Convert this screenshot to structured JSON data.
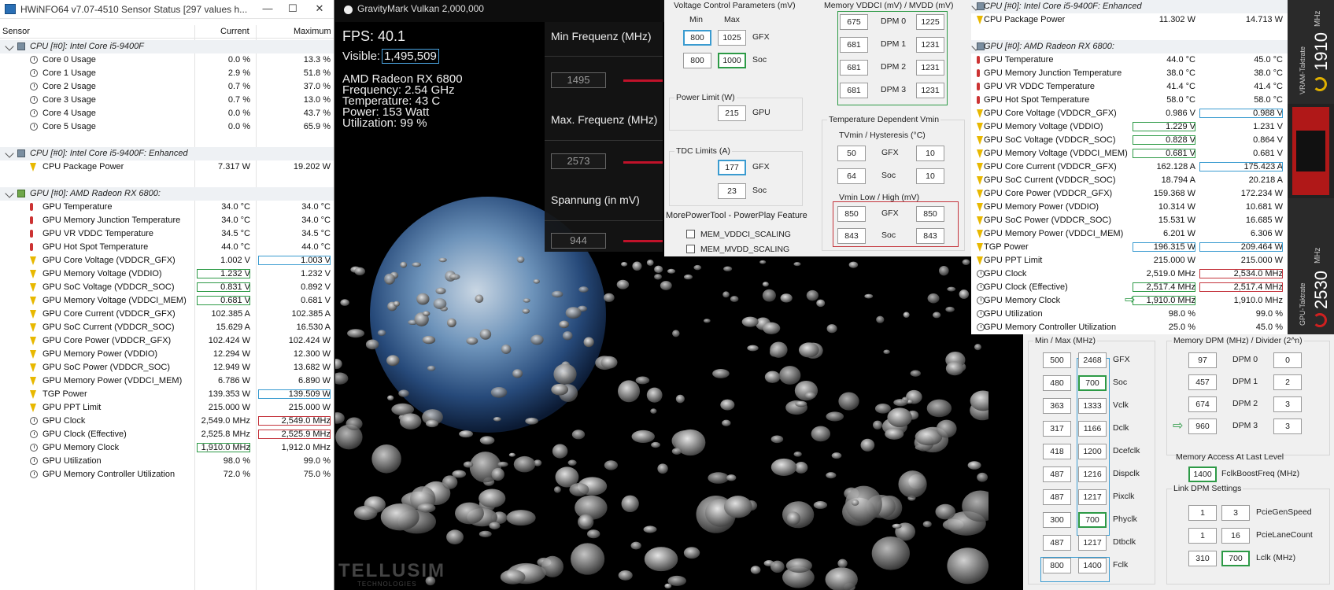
{
  "hwinfo": {
    "title": "HWiNFO64 v7.07-4510 Sensor Status [297 values h...",
    "col_sensor": "Sensor",
    "col_current": "Current",
    "col_max": "Maximum",
    "rows": [
      {
        "t": "g",
        "l": "CPU [#0]: Intel Core i5-9400F",
        "i": "cpu"
      },
      {
        "l": "Core 0 Usage",
        "c": "0.0 %",
        "m": "13.3 %",
        "i": "clock"
      },
      {
        "l": "Core 1 Usage",
        "c": "2.9 %",
        "m": "51.8 %",
        "i": "clock"
      },
      {
        "l": "Core 2 Usage",
        "c": "0.7 %",
        "m": "37.0 %",
        "i": "clock"
      },
      {
        "l": "Core 3 Usage",
        "c": "0.7 %",
        "m": "13.0 %",
        "i": "clock"
      },
      {
        "l": "Core 4 Usage",
        "c": "0.0 %",
        "m": "43.7 %",
        "i": "clock"
      },
      {
        "l": "Core 5 Usage",
        "c": "0.0 %",
        "m": "65.9 %",
        "i": "clock"
      },
      {
        "t": "s"
      },
      {
        "t": "g",
        "l": "CPU [#0]: Intel Core i5-9400F: Enhanced",
        "i": "cpu"
      },
      {
        "l": "CPU Package Power",
        "c": "7.317 W",
        "m": "19.202 W",
        "i": "bolt"
      },
      {
        "t": "s"
      },
      {
        "t": "g",
        "l": "GPU [#0]: AMD Radeon RX 6800:",
        "i": "gpu"
      },
      {
        "l": "GPU Temperature",
        "c": "34.0 °C",
        "m": "34.0 °C",
        "i": "therm"
      },
      {
        "l": "GPU Memory Junction Temperature",
        "c": "34.0 °C",
        "m": "34.0 °C",
        "i": "therm"
      },
      {
        "l": "GPU VR VDDC Temperature",
        "c": "34.5 °C",
        "m": "34.5 °C",
        "i": "therm"
      },
      {
        "l": "GPU Hot Spot Temperature",
        "c": "44.0 °C",
        "m": "44.0 °C",
        "i": "therm"
      },
      {
        "l": "GPU Core Voltage (VDDCR_GFX)",
        "c": "1.002 V",
        "m": "1.003 V",
        "i": "bolt",
        "mb": "b"
      },
      {
        "l": "GPU Memory Voltage (VDDIO)",
        "c": "1.232 V",
        "m": "1.232 V",
        "i": "bolt",
        "cb": "g"
      },
      {
        "l": "GPU SoC Voltage (VDDCR_SOC)",
        "c": "0.831 V",
        "m": "0.892 V",
        "i": "bolt",
        "cb": "g"
      },
      {
        "l": "GPU Memory Voltage (VDDCI_MEM)",
        "c": "0.681 V",
        "m": "0.681 V",
        "i": "bolt",
        "cb": "g"
      },
      {
        "l": "GPU Core Current (VDDCR_GFX)",
        "c": "102.385 A",
        "m": "102.385 A",
        "i": "bolt"
      },
      {
        "l": "GPU SoC Current (VDDCR_SOC)",
        "c": "15.629 A",
        "m": "16.530 A",
        "i": "bolt"
      },
      {
        "l": "GPU Core Power (VDDCR_GFX)",
        "c": "102.424 W",
        "m": "102.424 W",
        "i": "bolt"
      },
      {
        "l": "GPU Memory Power (VDDIO)",
        "c": "12.294 W",
        "m": "12.300 W",
        "i": "bolt"
      },
      {
        "l": "GPU SoC Power (VDDCR_SOC)",
        "c": "12.949 W",
        "m": "13.682 W",
        "i": "bolt"
      },
      {
        "l": "GPU Memory Power (VDDCI_MEM)",
        "c": "6.786 W",
        "m": "6.890 W",
        "i": "bolt"
      },
      {
        "l": "TGP Power",
        "c": "139.353 W",
        "m": "139.509 W",
        "i": "bolt",
        "mb": "b"
      },
      {
        "l": "GPU PPT Limit",
        "c": "215.000 W",
        "m": "215.000 W",
        "i": "bolt"
      },
      {
        "l": "GPU Clock",
        "c": "2,549.0 MHz",
        "m": "2,549.0 MHz",
        "i": "clock",
        "mb": "r"
      },
      {
        "l": "GPU Clock (Effective)",
        "c": "2,525.8 MHz",
        "m": "2,525.9 MHz",
        "i": "clock",
        "mb": "r"
      },
      {
        "l": "GPU Memory Clock",
        "c": "1,910.0 MHz",
        "m": "1,912.0 MHz",
        "i": "clock",
        "cb": "g"
      },
      {
        "l": "GPU Utilization",
        "c": "98.0 %",
        "m": "99.0 %",
        "i": "clock"
      },
      {
        "l": "GPU Memory Controller Utilization",
        "c": "72.0 %",
        "m": "75.0 %",
        "i": "clock"
      }
    ]
  },
  "gravitymark": {
    "title": "GravityMark Vulkan 2,000,000",
    "fps": "FPS: 40.1",
    "visible_label": "Visible:",
    "visible_value": "1,495,509",
    "gpu": "AMD Radeon RX 6800",
    "frequency": "Frequency: 2.54 GHz",
    "temperature": "Temperature: 43 C",
    "power": "Power: 153 Watt",
    "utilization": "Utilization: 99 %",
    "controls": [
      {
        "label": "Min Frequenz (MHz)",
        "value": "1495"
      },
      {
        "label": "Max. Frequenz (MHz)",
        "value": "2573"
      },
      {
        "label": "Spannung (in mV)",
        "value": "944"
      }
    ],
    "watermark": "TELLUSIM",
    "watermark_sub": "TECHNOLOGIES"
  },
  "mpt1": {
    "vcp_title": "Voltage Control Parameters (mV)",
    "min": "Min",
    "max": "Max",
    "gfx_min": "800",
    "gfx_max": "1025",
    "soc_min": "800",
    "soc_max": "1000",
    "gfx": "GFX",
    "soc": "Soc",
    "pl_title": "Power Limit (W)",
    "pl": "215",
    "gpu": "GPU",
    "tdc_title": "TDC Limits (A)",
    "tdc_gfx": "177",
    "tdc_soc": "23",
    "feature_title": "MorePowerTool - PowerPlay Feature",
    "feat1": "MEM_VDDCI_SCALING",
    "feat2": "MEM_MVDD_SCALING",
    "mem_title": "Memory VDDCI (mV) / MVDD (mV)",
    "dpm": [
      {
        "a": "675",
        "l": "DPM 0",
        "b": "1225"
      },
      {
        "a": "681",
        "l": "DPM 1",
        "b": "1231"
      },
      {
        "a": "681",
        "l": "DPM 2",
        "b": "1231"
      },
      {
        "a": "681",
        "l": "DPM 3",
        "b": "1231"
      }
    ],
    "tdv_title": "Temperature Dependent Vmin",
    "tvmin": "TVmin / Hysteresis (°C)",
    "tv_gfx_a": "50",
    "tv_gfx_b": "10",
    "tv_soc_a": "64",
    "tv_soc_b": "10",
    "vmin_title": "Vmin Low / High (mV)",
    "vm_gfx_a": "850",
    "vm_gfx_b": "850",
    "vm_soc_a": "843",
    "vm_soc_b": "843"
  },
  "hw2": {
    "rows": [
      {
        "t": "g",
        "l": "CPU [#0]: Intel Core i5-9400F: Enhanced"
      },
      {
        "l": "CPU Package Power",
        "c": "11.302 W",
        "m": "14.713 W",
        "i": "bolt"
      },
      {
        "t": "s"
      },
      {
        "t": "g",
        "l": "GPU [#0]: AMD Radeon RX 6800:"
      },
      {
        "l": "GPU Temperature",
        "c": "44.0 °C",
        "m": "45.0 °C",
        "i": "therm"
      },
      {
        "l": "GPU Memory Junction Temperature",
        "c": "38.0 °C",
        "m": "38.0 °C",
        "i": "therm"
      },
      {
        "l": "GPU VR VDDC Temperature",
        "c": "41.4 °C",
        "m": "41.4 °C",
        "i": "therm"
      },
      {
        "l": "GPU Hot Spot Temperature",
        "c": "58.0 °C",
        "m": "58.0 °C",
        "i": "therm"
      },
      {
        "l": "GPU Core Voltage (VDDCR_GFX)",
        "c": "0.986 V",
        "m": "0.988 V",
        "i": "bolt",
        "mb": "b"
      },
      {
        "l": "GPU Memory Voltage (VDDIO)",
        "c": "1.229 V",
        "m": "1.231 V",
        "i": "bolt",
        "cb": "g"
      },
      {
        "l": "GPU SoC Voltage (VDDCR_SOC)",
        "c": "0.828 V",
        "m": "0.864 V",
        "i": "bolt",
        "cb": "g"
      },
      {
        "l": "GPU Memory Voltage (VDDCI_MEM)",
        "c": "0.681 V",
        "m": "0.681 V",
        "i": "bolt",
        "cb": "g"
      },
      {
        "l": "GPU Core Current (VDDCR_GFX)",
        "c": "162.128 A",
        "m": "175.423 A",
        "i": "bolt",
        "mb": "b"
      },
      {
        "l": "GPU SoC Current (VDDCR_SOC)",
        "c": "18.794 A",
        "m": "20.218 A",
        "i": "bolt"
      },
      {
        "l": "GPU Core Power (VDDCR_GFX)",
        "c": "159.368 W",
        "m": "172.234 W",
        "i": "bolt"
      },
      {
        "l": "GPU Memory Power (VDDIO)",
        "c": "10.314 W",
        "m": "10.681 W",
        "i": "bolt"
      },
      {
        "l": "GPU SoC Power (VDDCR_SOC)",
        "c": "15.531 W",
        "m": "16.685 W",
        "i": "bolt"
      },
      {
        "l": "GPU Memory Power (VDDCI_MEM)",
        "c": "6.201 W",
        "m": "6.306 W",
        "i": "bolt"
      },
      {
        "l": "TGP Power",
        "c": "196.315 W",
        "m": "209.464 W",
        "i": "bolt",
        "cb": "b",
        "mb": "b"
      },
      {
        "l": "GPU PPT Limit",
        "c": "215.000 W",
        "m": "215.000 W",
        "i": "bolt"
      },
      {
        "l": "GPU Clock",
        "c": "2,519.0 MHz",
        "m": "2,534.0 MHz",
        "i": "clock",
        "mb": "r"
      },
      {
        "l": "GPU Clock (Effective)",
        "c": "2,517.4 MHz",
        "m": "2,517.4 MHz",
        "i": "clock",
        "cb": "g",
        "mb": "r"
      },
      {
        "l": "GPU Memory Clock",
        "c": "1,910.0 MHz",
        "m": "1,910.0 MHz",
        "i": "clock",
        "cb": "g",
        "arrow": true
      },
      {
        "l": "GPU Utilization",
        "c": "98.0 %",
        "m": "99.0 %",
        "i": "clock"
      },
      {
        "l": "GPU Memory Controller Utilization",
        "c": "25.0 %",
        "m": "45.0 %",
        "i": "clock"
      }
    ]
  },
  "mpt2": {
    "minmax_title": "Min / Max (MHz)",
    "clocks": [
      {
        "a": "500",
        "b": "2468",
        "l": "GFX"
      },
      {
        "a": "480",
        "b": "700",
        "l": "Soc",
        "bb": "g"
      },
      {
        "a": "363",
        "b": "1333",
        "l": "Vclk"
      },
      {
        "a": "317",
        "b": "1166",
        "l": "Dclk"
      },
      {
        "a": "418",
        "b": "1200",
        "l": "Dcefclk"
      },
      {
        "a": "487",
        "b": "1216",
        "l": "Dispclk"
      },
      {
        "a": "487",
        "b": "1217",
        "l": "Pixclk"
      },
      {
        "a": "300",
        "b": "700",
        "l": "Phyclk",
        "bb": "g"
      },
      {
        "a": "487",
        "b": "1217",
        "l": "Dtbclk"
      },
      {
        "a": "800",
        "b": "1400",
        "l": "Fclk"
      }
    ],
    "mdpm_title": "Memory DPM (MHz) / Divider (2^n)",
    "mdpm": [
      {
        "a": "97",
        "l": "DPM 0",
        "b": "0"
      },
      {
        "a": "457",
        "l": "DPM 1",
        "b": "2"
      },
      {
        "a": "674",
        "l": "DPM 2",
        "b": "3"
      },
      {
        "a": "960",
        "l": "DPM 3",
        "b": "3"
      }
    ],
    "mal_title": "Memory Access At Last Level",
    "mal_val": "1400",
    "mal_lbl": "FclkBoostFreq (MHz)",
    "link_title": "Link DPM Settings",
    "link": [
      {
        "a": "1",
        "b": "3",
        "l": "PcieGenSpeed"
      },
      {
        "a": "1",
        "b": "16",
        "l": "PcieLaneCount"
      },
      {
        "a": "310",
        "b": "700",
        "l": "Lclk (MHz)",
        "bb": "g"
      }
    ]
  },
  "side": {
    "vram_label": "VRAM-Taktrate",
    "vram_val": "1910",
    "vram_unit": "MHz",
    "gpu_label": "GPU-Taktrate",
    "gpu_val": "2530",
    "gpu_unit": "MHz"
  }
}
